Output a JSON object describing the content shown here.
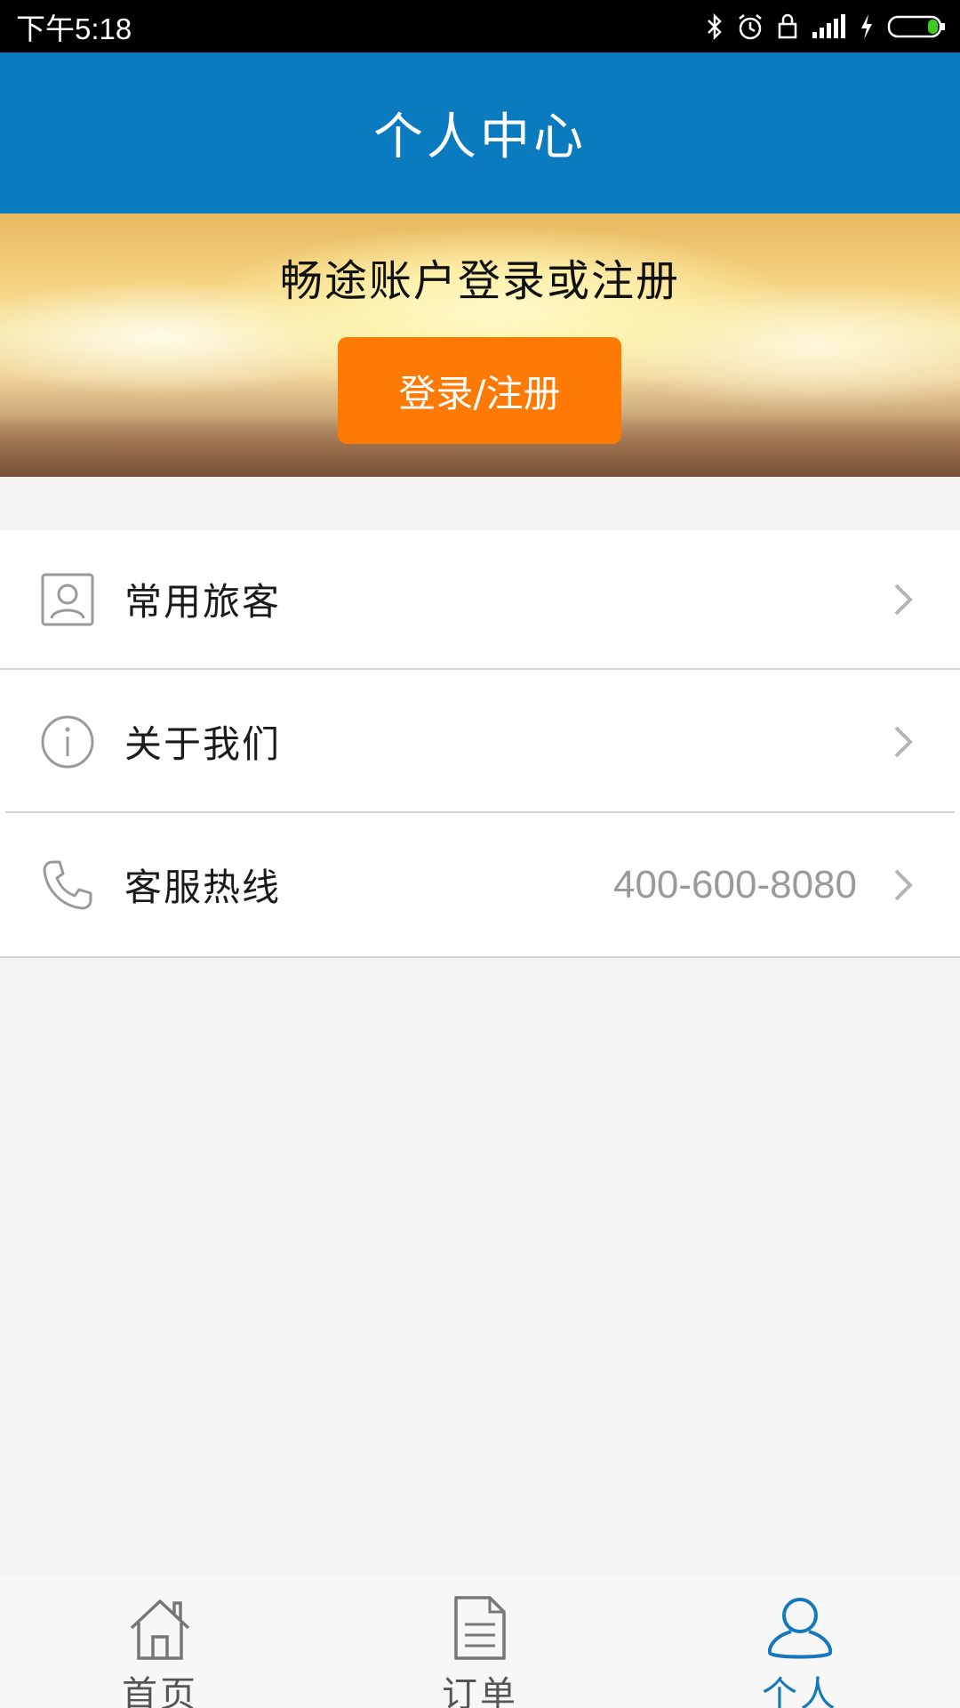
{
  "status_bar": {
    "time": "下午5:18",
    "icons": [
      "bluetooth-icon",
      "alarm-icon",
      "lock-icon",
      "signal-icon",
      "charging-icon",
      "battery-icon"
    ],
    "battery_color": "#3ecb1f"
  },
  "header": {
    "title": "个人中心",
    "background_color": "#0a7bbe"
  },
  "banner": {
    "title": "畅途账户登录或注册",
    "login_button_label": "登录/注册",
    "button_color": "#ff7a05"
  },
  "menu": {
    "items": [
      {
        "label": "常用旅客",
        "icon": "contact-card-icon",
        "value": ""
      },
      {
        "label": "关于我们",
        "icon": "info-icon",
        "value": ""
      },
      {
        "label": "客服热线",
        "icon": "phone-icon",
        "value": "400-600-8080"
      }
    ]
  },
  "tab_bar": {
    "tabs": [
      {
        "label": "首页",
        "icon": "home-icon",
        "active": false
      },
      {
        "label": "订单",
        "icon": "document-icon",
        "active": false
      },
      {
        "label": "个人",
        "icon": "person-icon",
        "active": true
      }
    ],
    "active_color": "#1677bd"
  }
}
